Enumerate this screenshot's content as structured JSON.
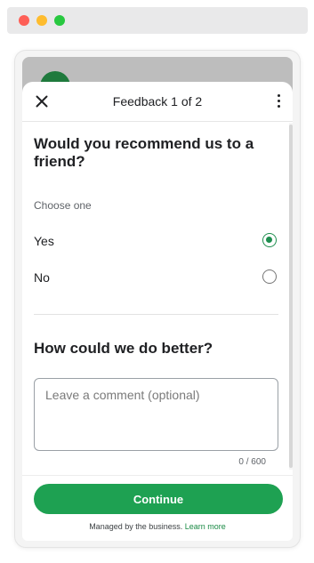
{
  "header": {
    "title": "Feedback 1 of 2"
  },
  "question1": {
    "text": "Would you recommend us to a friend?",
    "hint": "Choose one",
    "options": [
      {
        "label": "Yes",
        "selected": true
      },
      {
        "label": "No",
        "selected": false
      }
    ]
  },
  "question2": {
    "text": "How could we do better?",
    "placeholder": "Leave a comment (optional)",
    "value": "",
    "counter": "0 / 600"
  },
  "footer": {
    "continue_label": "Continue",
    "managed_text": "Managed by the business.",
    "learn_more": "Learn more"
  },
  "colors": {
    "accent": "#1ea152",
    "link": "#1a8a45"
  },
  "icons": {
    "close": "close-icon",
    "more": "more-vert-icon"
  }
}
